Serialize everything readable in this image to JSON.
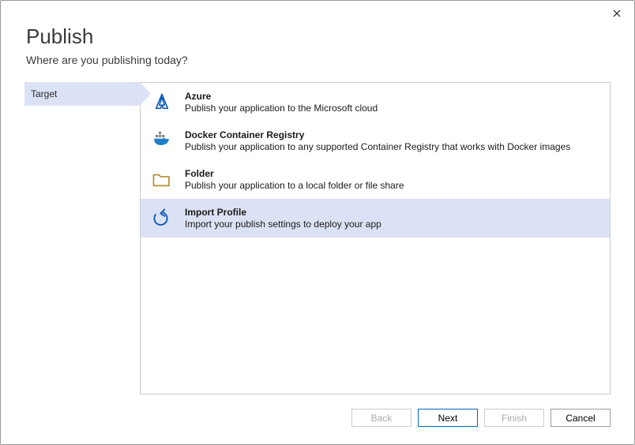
{
  "header": {
    "title": "Publish",
    "subtitle": "Where are you publishing today?"
  },
  "sidebar": {
    "steps": [
      {
        "label": "Target",
        "active": true
      }
    ]
  },
  "targets": [
    {
      "id": "azure",
      "title": "Azure",
      "desc": "Publish your application to the Microsoft cloud",
      "icon": "azure-icon",
      "selected": false
    },
    {
      "id": "docker",
      "title": "Docker Container Registry",
      "desc": "Publish your application to any supported Container Registry that works with Docker images",
      "icon": "docker-icon",
      "selected": false
    },
    {
      "id": "folder",
      "title": "Folder",
      "desc": "Publish your application to a local folder or file share",
      "icon": "folder-icon",
      "selected": false
    },
    {
      "id": "import-profile",
      "title": "Import Profile",
      "desc": "Import your publish settings to deploy your app",
      "icon": "import-icon",
      "selected": true
    }
  ],
  "footer": {
    "back": "Back",
    "next": "Next",
    "finish": "Finish",
    "cancel": "Cancel"
  }
}
